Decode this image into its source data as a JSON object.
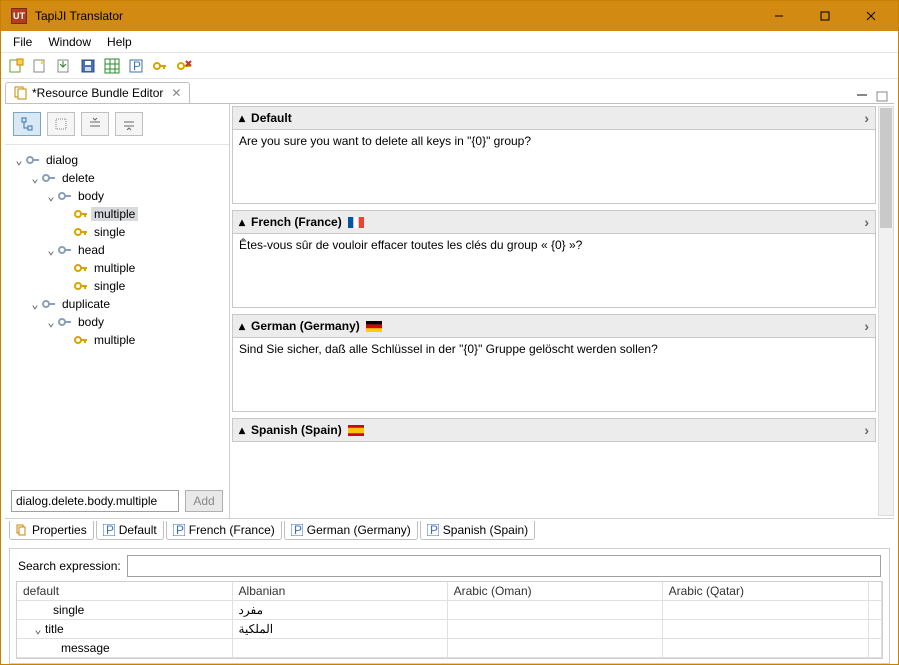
{
  "window": {
    "title": "TapiJI Translator"
  },
  "menu": {
    "file": "File",
    "window": "Window",
    "help": "Help"
  },
  "editor_tab": {
    "title": "*Resource Bundle Editor"
  },
  "tree": {
    "root": "dialog",
    "n_delete": "delete",
    "n_delete_body": "body",
    "n_delete_body_multiple": "multiple",
    "n_delete_body_single": "single",
    "n_delete_head": "head",
    "n_delete_head_multiple": "multiple",
    "n_delete_head_single": "single",
    "n_duplicate": "duplicate",
    "n_duplicate_body": "body",
    "n_duplicate_body_multiple": "multiple"
  },
  "keypath": {
    "value": "dialog.delete.body.multiple",
    "add_label": "Add"
  },
  "langs": {
    "default": {
      "label": "Default",
      "text": "Are you sure you want to delete all keys in \"{0}\" group?"
    },
    "fr": {
      "label": "French (France)",
      "text": "Êtes-vous sûr de vouloir effacer toutes les clés du group « {0} »?"
    },
    "de": {
      "label": "German (Germany)",
      "text": "Sind Sie sicher, daß alle Schlüssel in der \"{0}\" Gruppe gelöscht werden sollen?"
    },
    "es": {
      "label": "Spanish (Spain)",
      "text": ""
    }
  },
  "bottom_tabs": {
    "properties": "Properties",
    "default": "Default",
    "fr": "French (France)",
    "de": "German (Germany)",
    "es": "Spanish (Spain)"
  },
  "search": {
    "label": "Search expression:",
    "value": ""
  },
  "grid": {
    "headers": {
      "c0": "default",
      "c1": "Albanian",
      "c2": "Arabic (Oman)",
      "c3": "Arabic (Qatar)"
    },
    "rows": [
      {
        "indent": 2,
        "tw": "",
        "c0": "single",
        "c1": "مفرد",
        "c2": "",
        "c3": ""
      },
      {
        "indent": 1,
        "tw": "⌄",
        "c0": "title",
        "c1": "الملكية",
        "c2": "",
        "c3": ""
      },
      {
        "indent": 3,
        "tw": "",
        "c0": "message",
        "c1": "",
        "c2": "",
        "c3": ""
      }
    ]
  },
  "icons": {
    "collapse": "▾",
    "key_color": "#d9a400"
  }
}
